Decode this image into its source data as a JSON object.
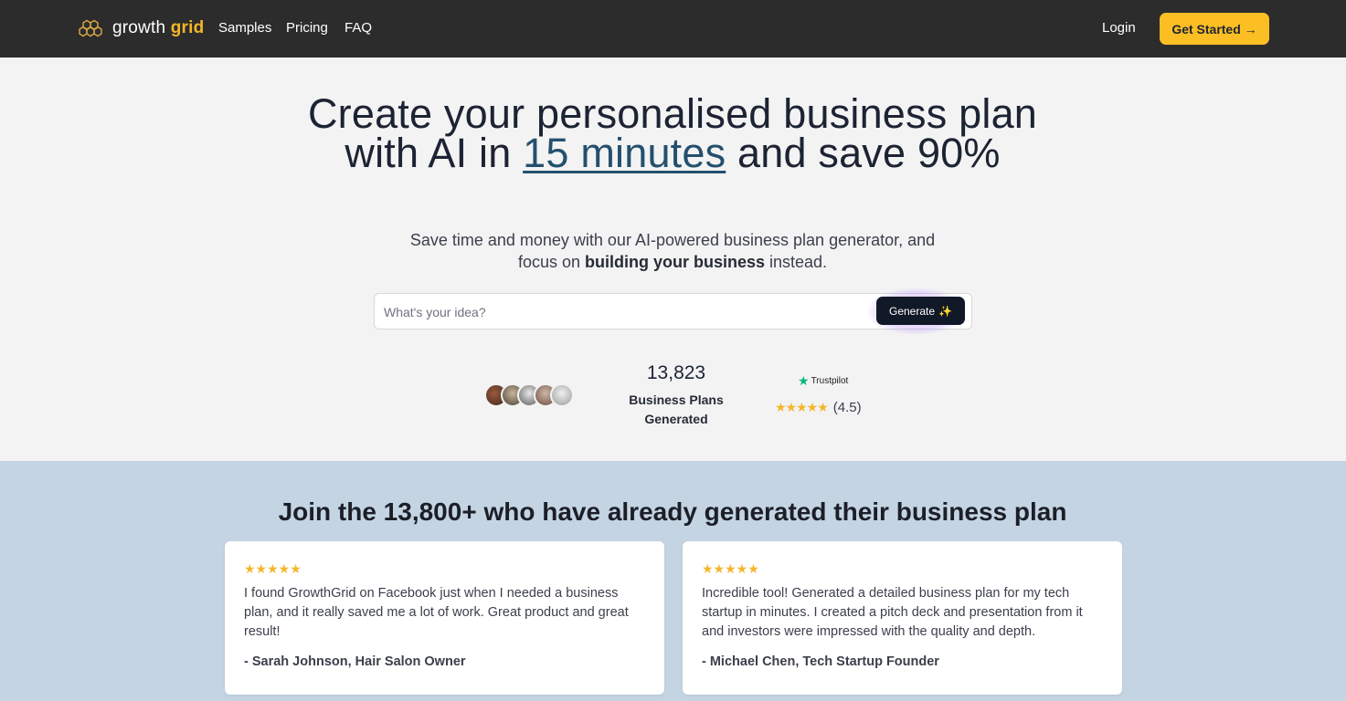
{
  "nav": {
    "logo": {
      "word1": "growth",
      "word2": "grid"
    },
    "links": [
      "Samples",
      "Pricing",
      "FAQ"
    ],
    "login": "Login",
    "cta": "Get Started →"
  },
  "hero": {
    "headline_pre": "Create your personalised business plan with AI in ",
    "headline_highlight": "15 minutes",
    "headline_post": " and save 90%",
    "sub_pre": "Save time and money with our AI-powered business plan generator, and focus on ",
    "sub_bold": "building your business",
    "sub_post": " instead.",
    "search_placeholder": "What's your idea?",
    "generate_label": "Generate",
    "generate_icon": "✨",
    "stat_number": "13,823",
    "stat_label": "Business Plans Generated",
    "trustpilot_label": "Trustpilot",
    "rating_stars": "★★★★★",
    "rating_value": "(4.5)"
  },
  "testimonials": {
    "title": "Join the 13,800+ who have already generated their business plan",
    "items": [
      {
        "stars": "★★★★★",
        "text": "I found GrowthGrid on Facebook just when I needed a business plan, and it really saved me a lot of work. Great product and great result!",
        "author": "- Sarah Johnson, Hair Salon Owner"
      },
      {
        "stars": "★★★★★",
        "text": "Incredible tool! Generated a detailed business plan for my tech startup in minutes. I created a pitch deck and presentation from it and investors were impressed with the quality and depth.",
        "author": "- Michael Chen, Tech Startup Founder"
      }
    ]
  },
  "colors": {
    "nav_bg": "#2c2c2c",
    "accent": "#fbbf24",
    "highlight": "#24506e",
    "section_bg": "#c4d4e3",
    "trustpilot_green": "#00b67a"
  }
}
